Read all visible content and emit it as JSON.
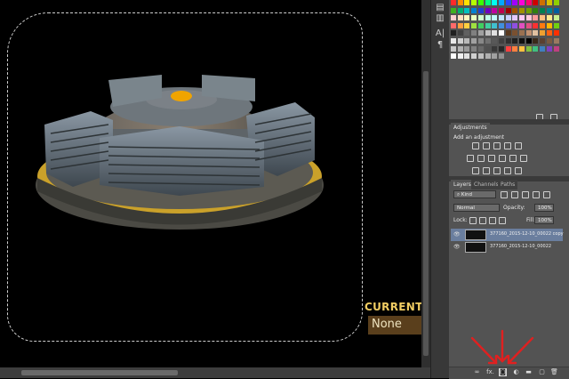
{
  "canvas": {
    "hud_title": "CURRENT MO",
    "hud_value": "None"
  },
  "adjustments": {
    "tab": "Adjustments",
    "add_label": "Add an adjustment"
  },
  "layers": {
    "tabs": [
      "Layers",
      "Channels",
      "Paths"
    ],
    "filter_value": "Kind",
    "blend_mode": "Normal",
    "opacity_label": "Opacity:",
    "opacity_value": "100%",
    "lock_label": "Lock:",
    "fill_label": "Fill:",
    "fill_value": "100%",
    "items": [
      {
        "name": "377160_2015-12-10_00022 copy",
        "selected": true
      },
      {
        "name": "377160_2015-12-10_00022",
        "selected": false
      }
    ]
  },
  "footer_icons": [
    "link-layers-icon",
    "fx-icon",
    "add-mask-icon",
    "adjustment-layer-icon",
    "new-group-icon",
    "new-layer-icon",
    "delete-layer-icon"
  ],
  "footer_fx_label": "fx.",
  "annotation": {
    "arrow_color": "#e02020",
    "count": 3
  },
  "colors": {
    "accent": "#6a7e9e",
    "hud": "#f0cc62"
  }
}
